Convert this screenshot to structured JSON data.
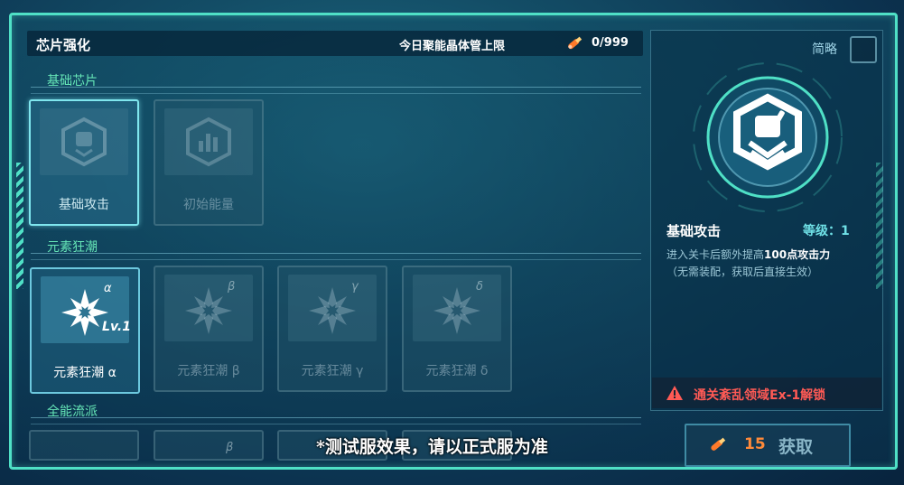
{
  "header": {
    "title": "芯片强化",
    "limit_label": "今日聚能晶体管上限",
    "counter": "0/999"
  },
  "sections": {
    "basic": "基础芯片",
    "element": "元素狂潮",
    "universal": "全能流派"
  },
  "cards": {
    "basic_attack": {
      "label": "基础攻击"
    },
    "initial_energy": {
      "label": "初始能量"
    },
    "alpha": {
      "label": "元素狂潮 α",
      "sup": "α",
      "level": "Lv.1"
    },
    "beta": {
      "label": "元素狂潮 β",
      "sup": "β"
    },
    "gamma": {
      "label": "元素狂潮 γ",
      "sup": "γ"
    },
    "delta": {
      "label": "元素狂潮 δ",
      "sup": "δ"
    },
    "row3_b_sup": "β"
  },
  "detail": {
    "simple_label": "简略",
    "name": "基础攻击",
    "level": "等级：1",
    "desc_prefix": "进入关卡后额外提高",
    "desc_value": "100点攻击力",
    "desc2": "（无需装配，获取后直接生效）",
    "unlock_text": "通关紊乱领域Ex-1解锁"
  },
  "get_button": {
    "cost": "15",
    "label": "获取"
  },
  "notice": "*测试服效果，请以正式服为准",
  "colors": {
    "accent": "#4fe0c6",
    "section_label": "#66e6b7",
    "warning": "#ff5a55",
    "cost": "#ff8a3a"
  }
}
